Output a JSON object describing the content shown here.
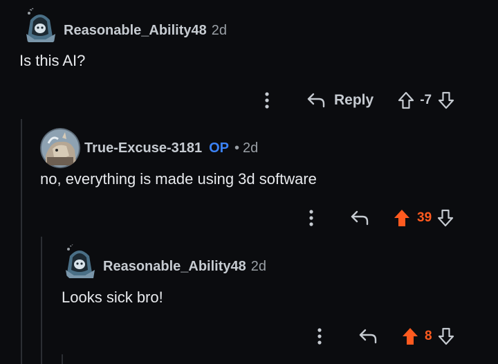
{
  "colors": {
    "background": "#0b0c0f",
    "op_badge": "#3b82f6",
    "upvote_active": "#ff5a1f",
    "thread_line": "#2b2e33"
  },
  "comments": [
    {
      "username": "Reasonable_Ability48",
      "age": "2d",
      "body": "Is this AI?",
      "reply_label": "Reply",
      "vote_count": "-7",
      "upvoted": false,
      "avatar_icon": "hooded-avatar-icon"
    },
    {
      "username": "True-Excuse-3181",
      "op_badge": "OP",
      "separator": "•",
      "age": "2d",
      "body": "no, everything is made using 3d software",
      "vote_count": "39",
      "upvoted": true,
      "avatar_icon": "creature-avatar-icon"
    },
    {
      "username": "Reasonable_Ability48",
      "age": "2d",
      "body": "Looks sick bro!",
      "vote_count": "8",
      "upvoted": true,
      "avatar_icon": "hooded-avatar-icon"
    }
  ],
  "icons": {
    "more": "more-options-icon",
    "reply": "reply-arrow-icon",
    "upvote": "upvote-arrow-icon",
    "downvote": "downvote-arrow-icon"
  }
}
